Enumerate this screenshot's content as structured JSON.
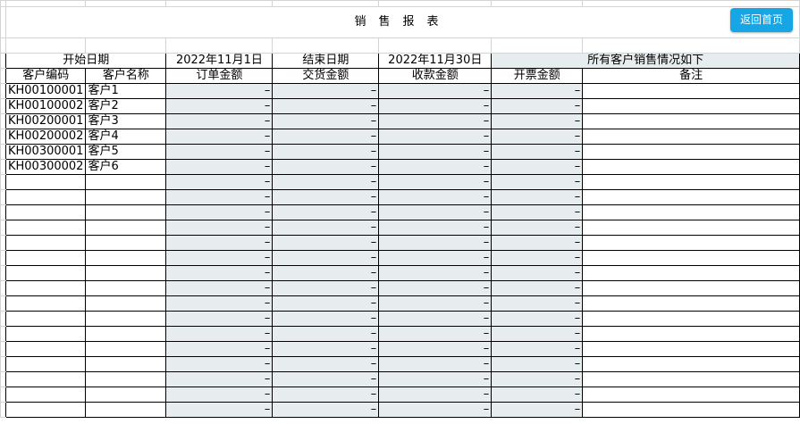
{
  "title": "销售报表",
  "back_button": "返回首页",
  "header1": {
    "start_label": "开始日期",
    "start_value": "2022年11月1日",
    "end_label": "结束日期",
    "end_value": "2022年11月30日",
    "summary": "所有客户销售情况如下"
  },
  "columns": [
    "客户编码",
    "客户名称",
    "订单金额",
    "交货金额",
    "收款金额",
    "开票金额",
    "备注"
  ],
  "dash": "–",
  "rows": [
    {
      "code": "KH00100001",
      "name": "客户1"
    },
    {
      "code": "KH00100002",
      "name": "客户2"
    },
    {
      "code": "KH00200001",
      "name": "客户3"
    },
    {
      "code": "KH00200002",
      "name": "客户4"
    },
    {
      "code": "KH00300001",
      "name": "客户5"
    },
    {
      "code": "KH00300002",
      "name": "客户6"
    },
    {
      "code": "",
      "name": ""
    },
    {
      "code": "",
      "name": ""
    },
    {
      "code": "",
      "name": ""
    },
    {
      "code": "",
      "name": ""
    },
    {
      "code": "",
      "name": ""
    },
    {
      "code": "",
      "name": ""
    },
    {
      "code": "",
      "name": ""
    },
    {
      "code": "",
      "name": ""
    },
    {
      "code": "",
      "name": ""
    },
    {
      "code": "",
      "name": ""
    },
    {
      "code": "",
      "name": ""
    },
    {
      "code": "",
      "name": ""
    },
    {
      "code": "",
      "name": ""
    },
    {
      "code": "",
      "name": ""
    },
    {
      "code": "",
      "name": ""
    },
    {
      "code": "",
      "name": ""
    }
  ]
}
